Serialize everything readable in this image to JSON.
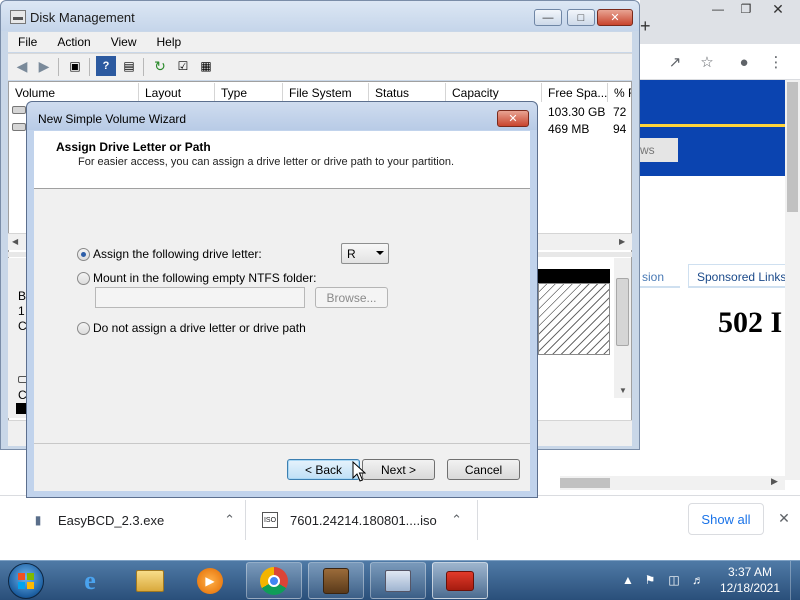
{
  "chrome": {
    "new_tab_glyph": "+",
    "site_tab_fragment": "ws",
    "site_tab2_fragment": "sion",
    "sponsored_label": "Sponsored Links",
    "error_heading": "502 I"
  },
  "downloads": {
    "items": [
      {
        "name": "EasyBCD_2.3.exe",
        "icon": "installer-icon"
      },
      {
        "name": "7601.24214.180801....iso",
        "icon": "iso-file-icon"
      }
    ],
    "show_all_label": "Show all"
  },
  "disk_management": {
    "title": "Disk Management",
    "menu": [
      "File",
      "Action",
      "View",
      "Help"
    ],
    "columns": [
      "Volume",
      "Layout",
      "Type",
      "File System",
      "Status",
      "Capacity",
      "Free Spa...",
      "% F"
    ],
    "rows": [
      {
        "free_space": "103.30 GB",
        "percent_free": "72"
      },
      {
        "free_space": "469 MB",
        "percent_free": "94"
      }
    ],
    "lower_pane_chars": [
      "B",
      "1",
      "C",
      "C"
    ]
  },
  "wizard": {
    "title": "New Simple Volume Wizard",
    "heading": "Assign Drive Letter or Path",
    "subheading": "For easier access, you can assign a drive letter or drive path to your partition.",
    "options": {
      "assign_letter": "Assign the following drive letter:",
      "mount_folder": "Mount in the following empty NTFS folder:",
      "no_assign": "Do not assign a drive letter or drive path"
    },
    "selected_option": "assign_letter",
    "drive_letter": "R",
    "browse_label": "Browse...",
    "back_label": "< Back",
    "next_label": "Next >",
    "cancel_label": "Cancel"
  },
  "taskbar": {
    "time": "3:37 AM",
    "date": "12/18/2021",
    "apps": [
      "internet-explorer-icon",
      "file-explorer-icon",
      "media-player-icon",
      "chrome-icon",
      "disk-tool-icon",
      "computer-management-icon",
      "toolbox-icon"
    ]
  },
  "colors": {
    "wizard_frame": "#c1d3ec",
    "taskbar": "#2a4f7a",
    "chrome_link": "#1a73e8"
  }
}
